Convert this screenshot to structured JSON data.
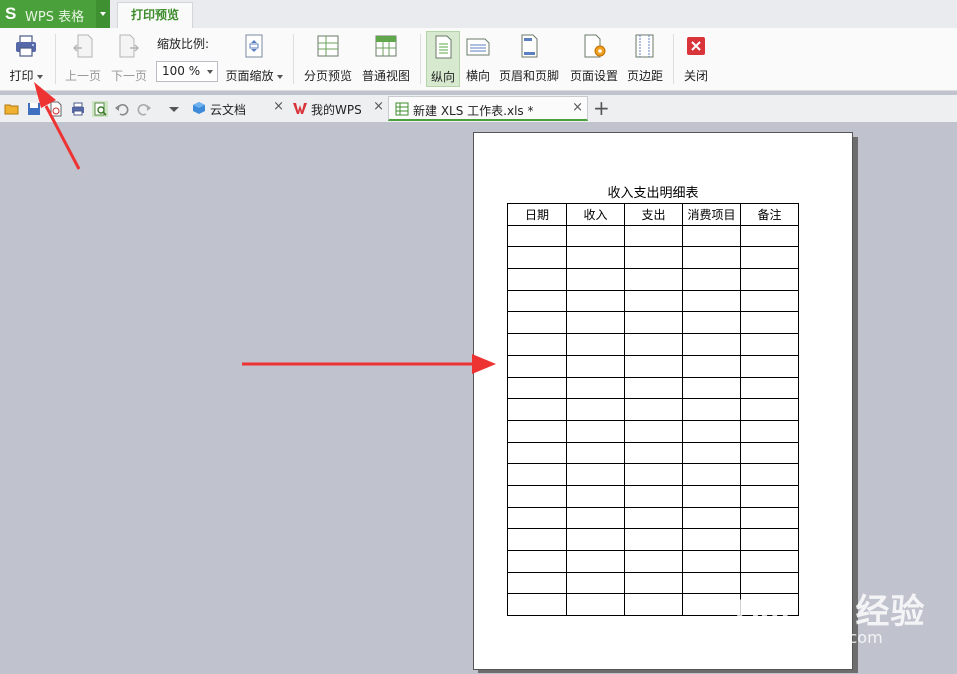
{
  "app": {
    "logo": "S",
    "title": "WPS 表格",
    "active_tab": "打印预览"
  },
  "ribbon": {
    "print": "打印",
    "prev_page": "上一页",
    "next_page": "下一页",
    "zoom_label": "缩放比例:",
    "zoom_value": "100 %",
    "page_zoom": "页面缩放",
    "page_break_preview": "分页预览",
    "normal_view": "普通视图",
    "portrait": "纵向",
    "landscape": "横向",
    "header_footer": "页眉和页脚",
    "page_setup": "页面设置",
    "margins": "页边距",
    "close": "关闭"
  },
  "doc_tabs": [
    {
      "label": "云文档",
      "icon": "cloud-cube-icon"
    },
    {
      "label": "我的WPS",
      "icon": "wps-w-icon"
    },
    {
      "label": "新建 XLS 工作表.xls *",
      "icon": "spreadsheet-icon"
    }
  ],
  "sheet": {
    "title": "收入支出明细表",
    "headers": [
      "日期",
      "收入",
      "支出",
      "消费项目",
      "备注"
    ],
    "empty_rows": 18
  },
  "watermark": {
    "logo": "Bai du 经验",
    "sub": "jingyan.baidu.com"
  },
  "colors": {
    "brand_green": "#4aa03a",
    "arrow_red": "#ee3333",
    "preview_bg": "#c0c3ce"
  }
}
